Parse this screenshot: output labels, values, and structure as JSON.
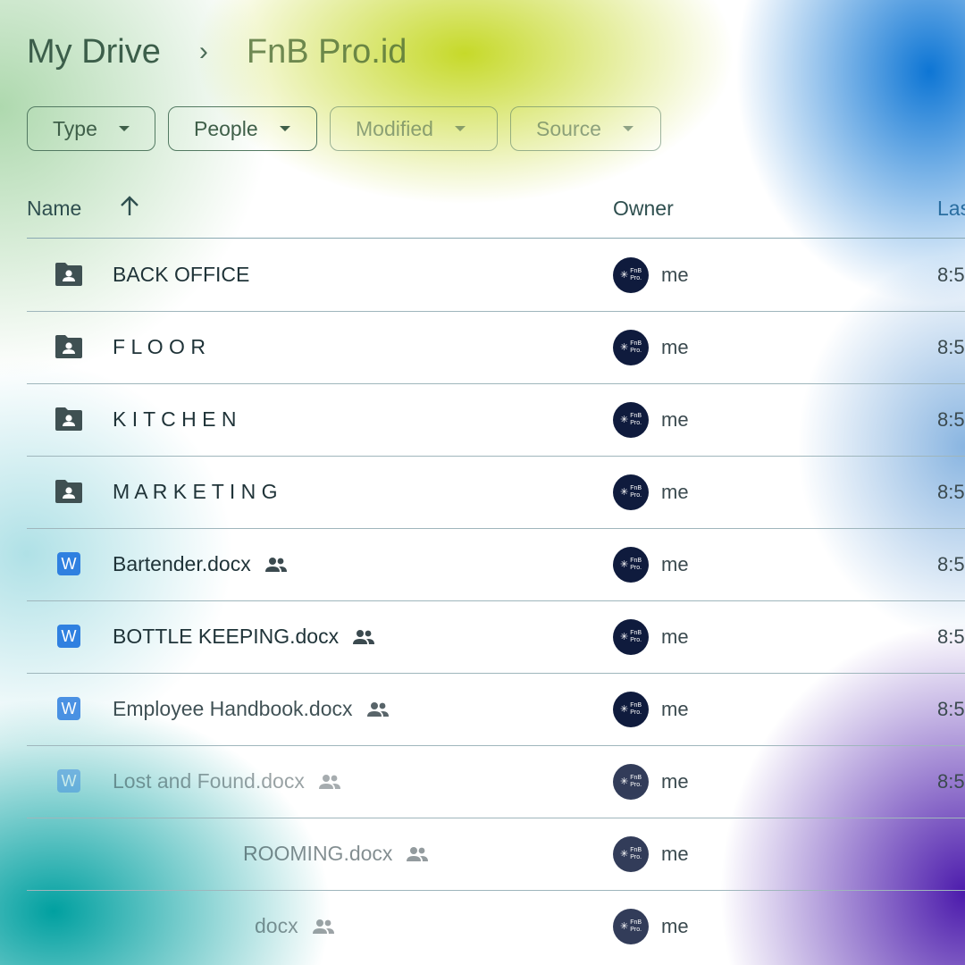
{
  "breadcrumb": {
    "root": "My Drive",
    "separator": "›",
    "current": "FnB Pro.id"
  },
  "filters": [
    {
      "label": "Type"
    },
    {
      "label": "People"
    },
    {
      "label": "Modified"
    },
    {
      "label": "Source"
    }
  ],
  "columns": {
    "name": "Name",
    "owner": "Owner",
    "last_modified": "Las"
  },
  "avatar": {
    "line1": "FnB",
    "line2": "Pro."
  },
  "rows": [
    {
      "name": "BACK OFFICE",
      "type": "folder",
      "owner": "me",
      "time": "8:5"
    },
    {
      "name": "F L O O R",
      "type": "folder",
      "owner": "me",
      "time": "8:5"
    },
    {
      "name": "K I T C H E N",
      "type": "folder",
      "owner": "me",
      "time": "8:5"
    },
    {
      "name": "M A R K E T I N G",
      "type": "folder",
      "owner": "me",
      "time": "8:5"
    },
    {
      "name": "Bartender.docx",
      "type": "word",
      "shared": true,
      "owner": "me",
      "time": "8:5"
    },
    {
      "name": "BOTTLE KEEPING.docx",
      "type": "word",
      "shared": true,
      "owner": "me",
      "time": "8:5"
    },
    {
      "name": "Employee Handbook.docx",
      "type": "word",
      "shared": true,
      "owner": "me",
      "time": "8:5"
    },
    {
      "name": "Lost and Found.docx",
      "type": "word",
      "shared": true,
      "owner": "me",
      "time": "8:5"
    },
    {
      "name": "ROOMING.docx",
      "type": "word",
      "shared": true,
      "owner": "me",
      "time": ""
    },
    {
      "name": "docx",
      "type": "word",
      "shared": true,
      "owner": "me",
      "time": ""
    }
  ],
  "word_icon_letter": "W",
  "colors": {
    "folder": "#3f5052",
    "word": "#2f80e0",
    "avatar_bg": "#0f1b3d"
  }
}
